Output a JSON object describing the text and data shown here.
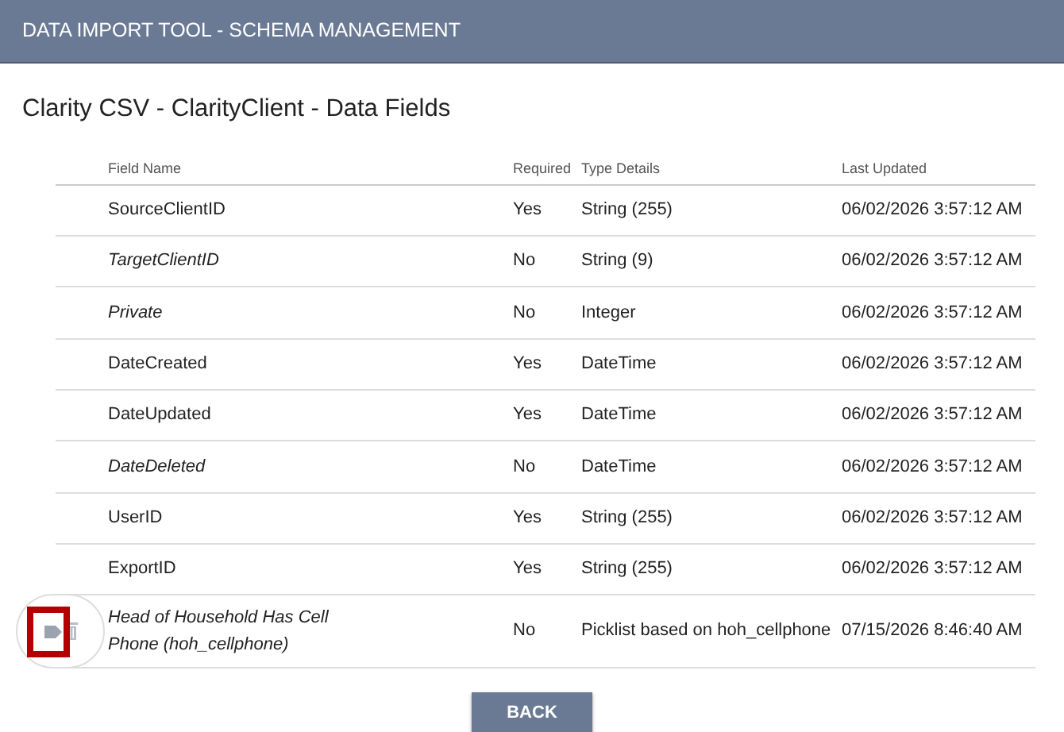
{
  "header": {
    "title": "DATA IMPORT TOOL - SCHEMA MANAGEMENT"
  },
  "page_title": "Clarity CSV - ClarityClient - Data Fields",
  "table": {
    "columns": [
      "Field Name",
      "Required",
      "Type Details",
      "Last Updated"
    ],
    "rows": [
      {
        "field": "SourceClientID",
        "italic": false,
        "required": "Yes",
        "type": "String (255)",
        "updated": "06/02/2026 3:57:12 AM",
        "hovered": false,
        "highlighted": false
      },
      {
        "field": "TargetClientID",
        "italic": true,
        "required": "No",
        "type": "String (9)",
        "updated": "06/02/2026 3:57:12 AM",
        "hovered": false,
        "highlighted": false
      },
      {
        "field": "Private",
        "italic": true,
        "required": "No",
        "type": "Integer",
        "updated": "06/02/2026 3:57:12 AM",
        "hovered": false,
        "highlighted": false
      },
      {
        "field": "DateCreated",
        "italic": false,
        "required": "Yes",
        "type": "DateTime",
        "updated": "06/02/2026 3:57:12 AM",
        "hovered": false,
        "highlighted": false
      },
      {
        "field": "DateUpdated",
        "italic": false,
        "required": "Yes",
        "type": "DateTime",
        "updated": "06/02/2026 3:57:12 AM",
        "hovered": false,
        "highlighted": false
      },
      {
        "field": "DateDeleted",
        "italic": true,
        "required": "No",
        "type": "DateTime",
        "updated": "06/02/2026 3:57:12 AM",
        "hovered": false,
        "highlighted": false
      },
      {
        "field": "UserID",
        "italic": false,
        "required": "Yes",
        "type": "String (255)",
        "updated": "06/02/2026 3:57:12 AM",
        "hovered": false,
        "highlighted": false
      },
      {
        "field": "ExportID",
        "italic": false,
        "required": "Yes",
        "type": "String (255)",
        "updated": "06/02/2026 3:57:12 AM",
        "hovered": false,
        "highlighted": false
      },
      {
        "field": "Head of Household Has Cell Phone (hoh_cellphone)",
        "italic": true,
        "required": "No",
        "type": "Picklist based on hoh_cellphone",
        "updated": "07/15/2026 8:46:40 AM",
        "hovered": true,
        "highlighted": true
      }
    ]
  },
  "back_button": "BACK"
}
